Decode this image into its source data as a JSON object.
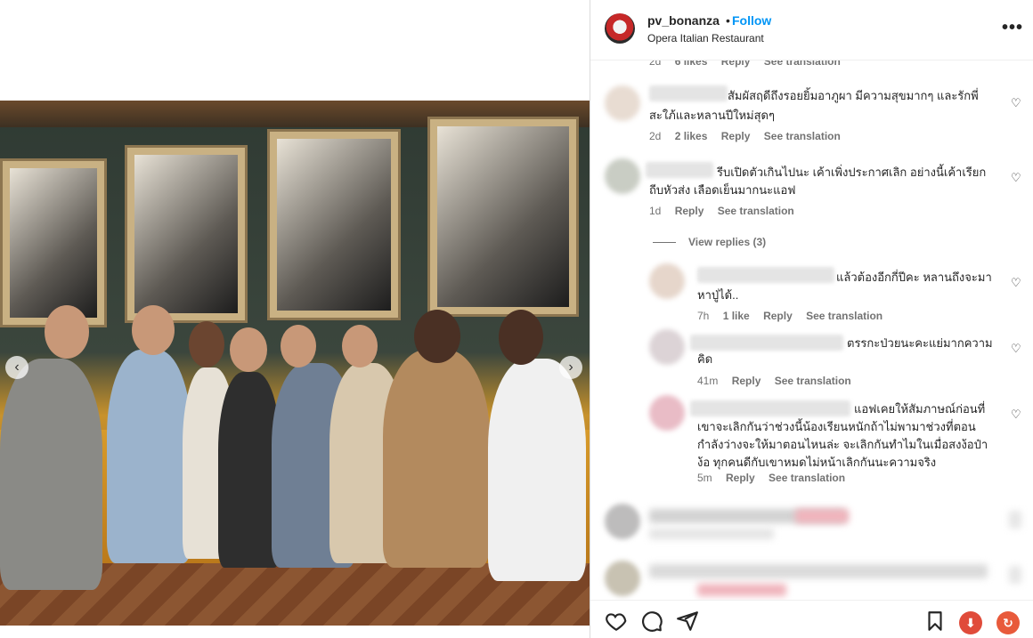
{
  "post": {
    "username": "pv_bonanza",
    "separator": "•",
    "follow_label": "Follow",
    "location": "Opera Italian Restaurant",
    "more_label": "•••"
  },
  "comments": {
    "top_partial": {
      "time": "2d",
      "likes": "6 likes",
      "reply": "Reply",
      "translate": "See translation"
    },
    "items": [
      {
        "text_line1": "สัมผัสฤดีถึงรอยยิ้มอาภูผา มีความสุขมากๆ และรักพี่",
        "text_line2": "สะใภ้และหลานปีใหม่สุดๆ",
        "time": "2d",
        "likes": "2 likes",
        "reply": "Reply",
        "translate": "See translation"
      },
      {
        "text_line1": "รีบเปิดตัวเกินไปนะ เค้าเพิ่งประกาศเลิก อย่างนี้เค้าเรียก",
        "text_line2": "ถีบหัวส่ง เลือดเย็นมากนะแอฟ",
        "time": "1d",
        "reply": "Reply",
        "translate": "See translation"
      }
    ],
    "view_replies": "View replies (3)",
    "replies": [
      {
        "text_line1": "แล้วต้องอีกกี่ปีคะ หลานถึงจะมา",
        "text_line2": "หาปู่ได้..",
        "time": "7h",
        "likes": "1 like",
        "reply": "Reply",
        "translate": "See translation"
      },
      {
        "text_line1": "ตรรกะป่วยนะคะแย่มากความ",
        "text_line2": "คิด",
        "time": "41m",
        "reply": "Reply",
        "translate": "See translation"
      },
      {
        "text_line1": "แอฟเคยให้สัมภาษณ์ก่อนที่",
        "text_line2": "เขาจะเลิกกันว่าช่วงนี้น้องเรียนหนักถ้าไม่พามาช่วงที่ตอน",
        "text_line3": "กำลังว่างจะให้มาตอนไหนล่ะ จะเลิกกันทำไมในเมื่อสงง้อป๋า",
        "text_line4": "ง้อ ทุกคนดีกับเขาหมดไม่หน้าเลิกกันนะความจริง",
        "time": "5m",
        "reply": "Reply",
        "translate": "See translation"
      }
    ]
  },
  "icons": {
    "heart": "heart-icon",
    "comment": "comment-icon",
    "share": "share-icon",
    "bookmark": "bookmark-icon",
    "download": "download-icon",
    "refresh": "refresh-icon"
  },
  "colors": {
    "accent": "#0095f6",
    "download_btn": "#e04b3a",
    "refresh_btn": "#e85a3b"
  }
}
